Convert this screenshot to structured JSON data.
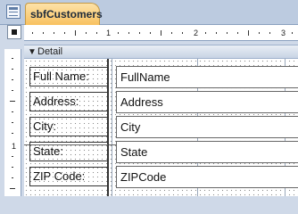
{
  "window": {
    "tab_title": "sbfCustomers",
    "tab_icon": "form-icon"
  },
  "ruler": {
    "marks": [
      "1",
      "2",
      "3"
    ],
    "left_marks": [
      "1"
    ]
  },
  "section": {
    "label": "Detail",
    "icon": "section-arrow-icon"
  },
  "controls": [
    {
      "label": "Full Name:",
      "field": "FullName"
    },
    {
      "label": "Address:",
      "field": "Address"
    },
    {
      "label": "City:",
      "field": "City"
    },
    {
      "label": "State:",
      "field": "State"
    },
    {
      "label": "ZIP Code:",
      "field": "ZIPCode"
    }
  ]
}
